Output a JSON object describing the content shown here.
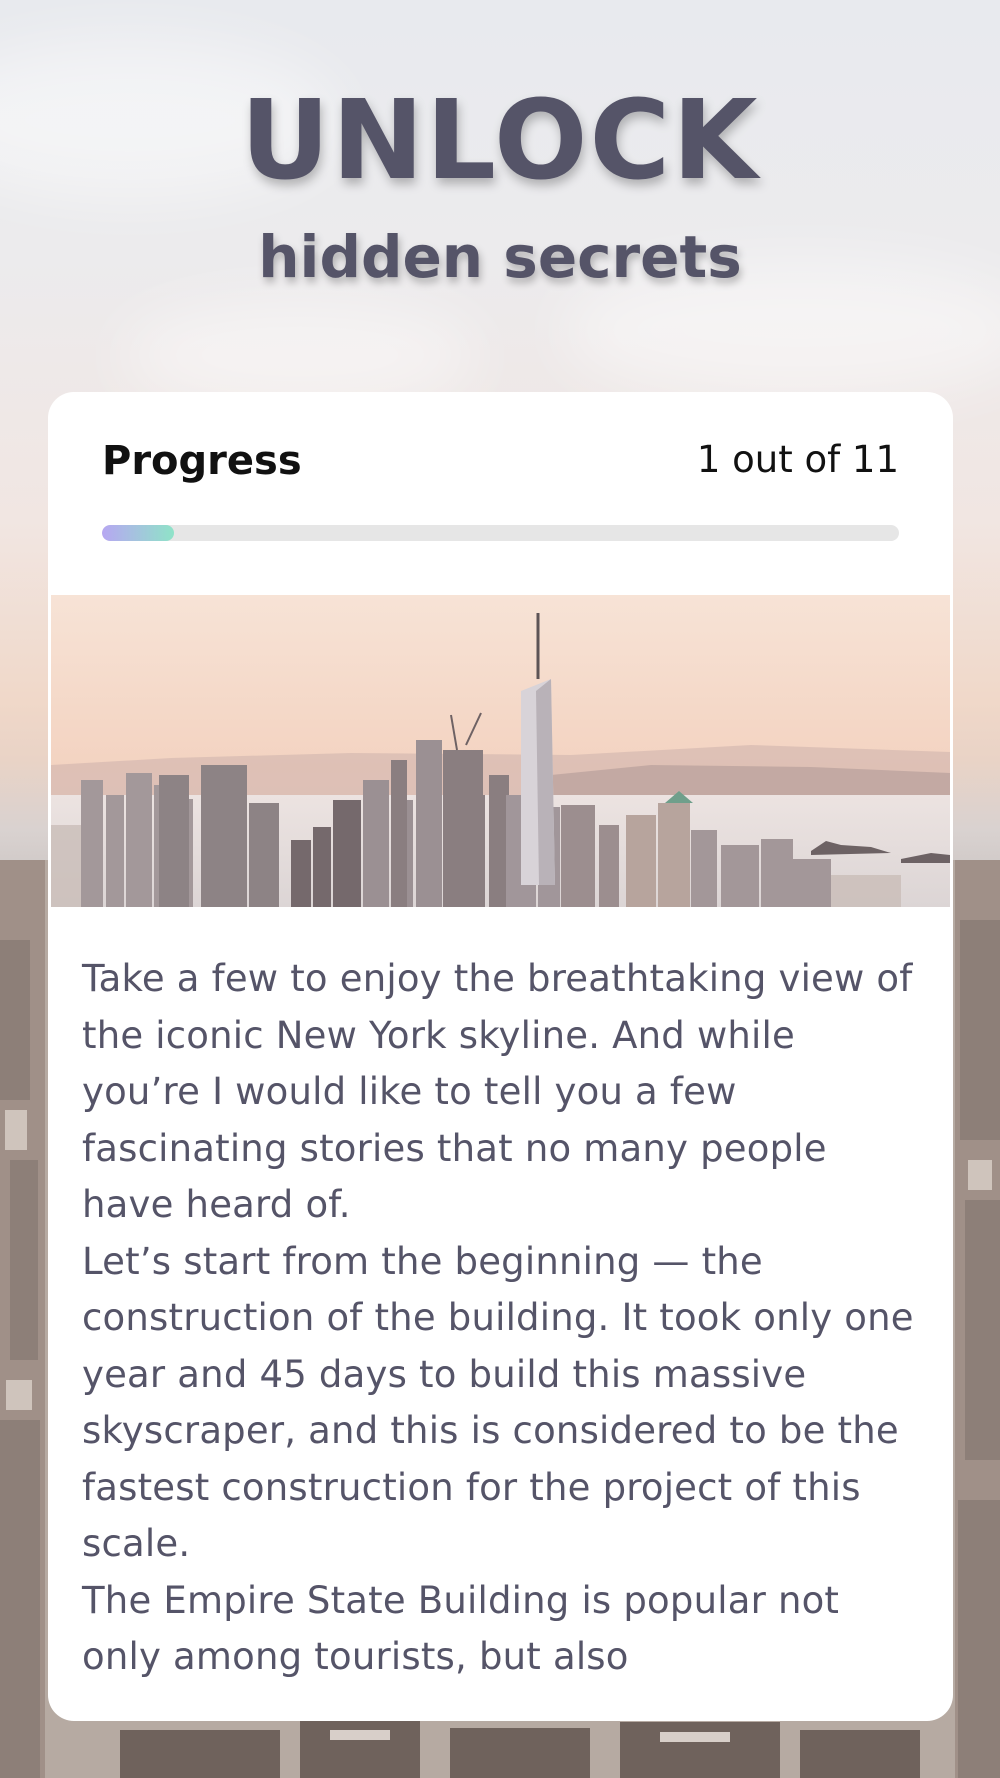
{
  "header": {
    "title": "UNLOCK",
    "subtitle": "hidden secrets"
  },
  "progress": {
    "label": "Progress",
    "count_text": "1 out of 11",
    "current": 1,
    "total": 11,
    "fill_fraction": 0.09,
    "fill_gradient": [
      "#b7a7f2",
      "#8fe3c8"
    ]
  },
  "story": {
    "paragraphs": [
      "Take a few to enjoy the breathtaking view of the iconic New York skyline. And while you’re I would like to tell you a few fascinating stories that no many people have heard of.",
      "Let’s start from the beginning — the construction of the building. It took only one year and 45 days to build this massive skyscraper, and this is considered to be the fastest construction for the project of this scale.",
      "The Empire State Building is popular not only among tourists, but also"
    ]
  },
  "colors": {
    "heading": "#555468",
    "body_text": "#555468",
    "card": "#ffffff",
    "track": "#e6e6e6"
  }
}
